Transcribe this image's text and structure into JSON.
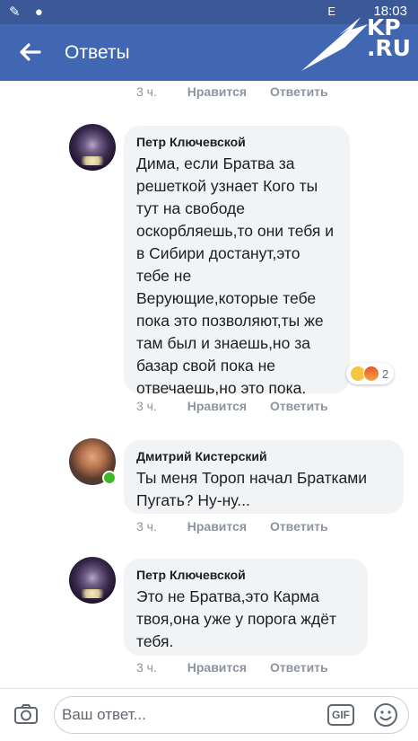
{
  "status_bar": {
    "signal": "E",
    "time": "18:03"
  },
  "app_bar": {
    "title": "Ответы"
  },
  "watermark": {
    "logo_text": "KP.RU"
  },
  "thread": {
    "top_actions": {
      "time": "3 ч.",
      "like": "Нравится",
      "reply": "Ответить"
    },
    "comments": [
      {
        "author": "Петр Ключевской",
        "text": "Дима, если Братва за решеткой узнает Кого ты тут на свободе оскорбляешь,то они тебя и в Сибири достанут,это тебе не Верующие,которые тебе пока это позволяют,ты же там был и знаешь,но за базар свой пока не отвечаешь,но это пока.",
        "reaction_count": "2",
        "time": "3 ч.",
        "like": "Нравится",
        "reply": "Ответить"
      },
      {
        "author": "Дмитрий Кистерский",
        "text": "Ты меня Тороп начал Братками Пугать? Ну-ну...",
        "time": "3 ч.",
        "like": "Нравится",
        "reply": "Ответить"
      },
      {
        "author": "Петр Ключевской",
        "text": "Это не Братва,это Карма твоя,она уже у порога ждёт тебя.",
        "time": "3 ч.",
        "like": "Нравится",
        "reply": "Ответить"
      }
    ]
  },
  "composer": {
    "placeholder": "Ваш ответ...",
    "gif_label": "GIF"
  },
  "colors": {
    "brand_blue": "#4267b2",
    "status_bar": "#3b5998",
    "bubble": "#f2f3f5",
    "meta_text": "#8d949e",
    "online": "#42b72a"
  }
}
